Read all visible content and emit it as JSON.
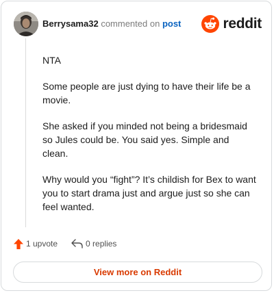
{
  "header": {
    "author": "Berrysama32",
    "action": "commented on",
    "post_link": "post",
    "brand": "reddit",
    "avatar_icon": "user-avatar-photo",
    "brand_icon": "reddit-snoo-icon"
  },
  "comment": {
    "paragraphs": [
      "NTA",
      "Some people are just dying to have their life be a movie.",
      "She asked if you minded not being a bridesmaid so Jules could be. You said yes. Simple and clean.",
      "Why would you “fight”? It’s childish for Bex to want you to start drama just and argue just so she can feel wanted."
    ]
  },
  "footer": {
    "upvotes": "1 upvote",
    "replies": "0 replies",
    "upvote_icon": "upvote-arrow-icon",
    "reply_icon": "reply-arrow-icon"
  },
  "view_button": "View more on Reddit",
  "colors": {
    "brand": "#ff4500",
    "link": "#0a63c0",
    "button_text": "#d93a00",
    "text": "#1c1c1c",
    "muted": "#7c7c7c"
  }
}
